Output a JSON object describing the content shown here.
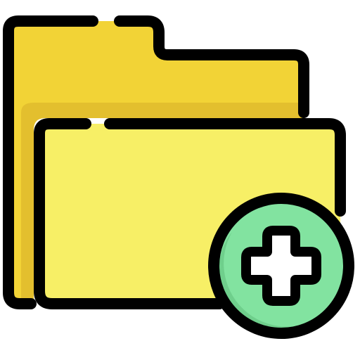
{
  "icon": {
    "name": "add-folder-icon",
    "parts": {
      "back_folder": "folder-back-icon",
      "front_folder": "folder-front-icon",
      "badge": "plus-circle-icon",
      "plus": "plus-icon"
    },
    "colors": {
      "folder_back": "#F2D336",
      "folder_back_shadow": "#E3BF2E",
      "folder_front": "#F7EF66",
      "badge_fill": "#82E3A0",
      "badge_shadow": "#6FCF8C",
      "plus_fill": "#FFFFFF",
      "outline": "#000000"
    }
  }
}
